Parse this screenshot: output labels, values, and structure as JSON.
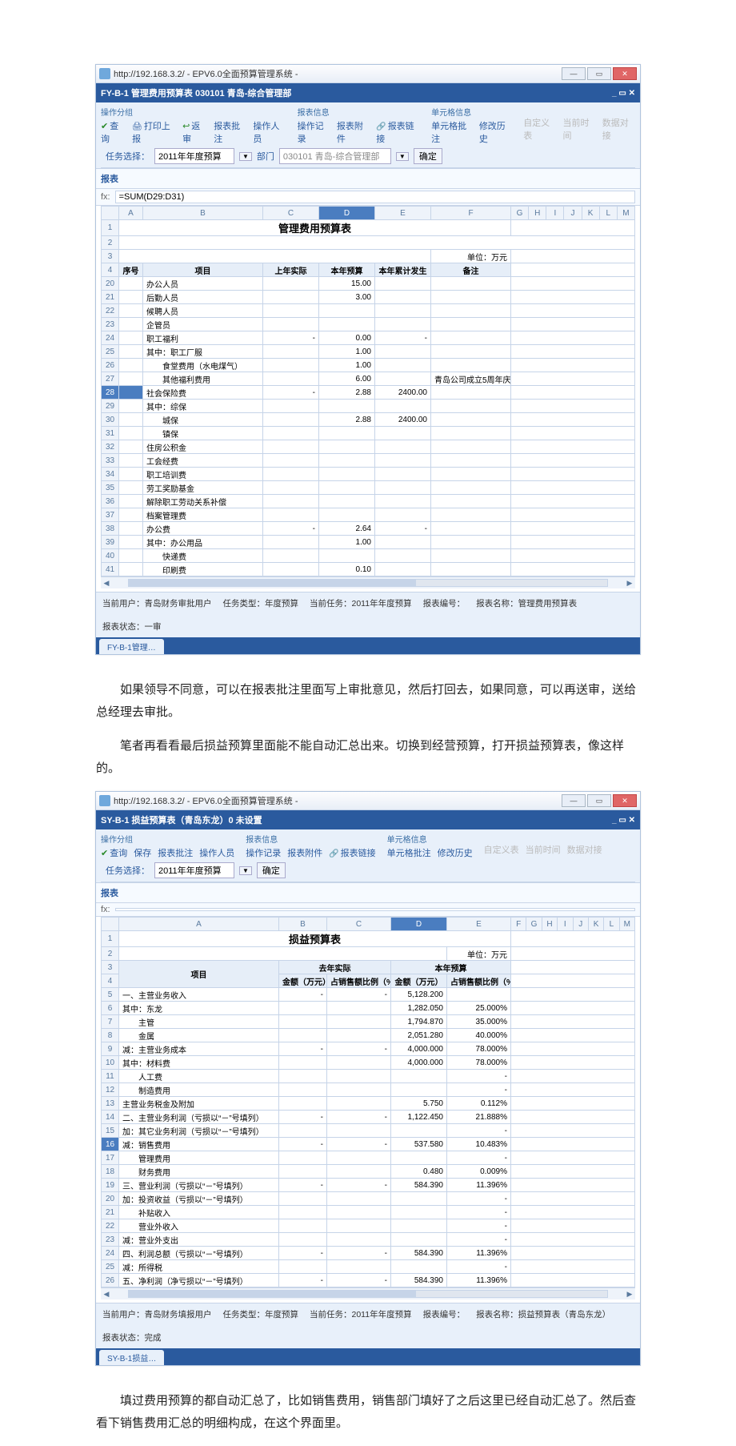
{
  "paragraphs": {
    "p1": "如果领导不同意，可以在报表批注里面写上审批意见，然后打回去，如果同意，可以再送审，送给总经理去审批。",
    "p2": "笔者再看看最后损益预算里面能不能自动汇总出来。切换到经营预算，打开损益预算表，像这样的。",
    "p3": "填过费用预算的都自动汇总了，比如销售费用，销售部门填好了之后这里已经自动汇总了。然后查看下销售费用汇总的明细构成，在这个界面里。"
  },
  "s1": {
    "window_title": "http://192.168.3.2/ - EPV6.0全面预算管理系统 -",
    "blue_title": "FY-B-1 管理费用预算表 030101 青岛-综合管理部",
    "ribbon": {
      "g1_title": "操作分组",
      "g1_items": [
        "查询",
        "打印上报",
        "返审",
        "报表批注",
        "操作人员"
      ],
      "g2_title": "报表信息",
      "g2_items": [
        "操作记录",
        "报表附件",
        "报表链接"
      ],
      "g3_title": "单元格信息",
      "g3_items": [
        "单元格批注",
        "修改历史"
      ],
      "g4_title": "",
      "g4_items": [
        "自定义表",
        "当前时间",
        "数据对接"
      ]
    },
    "task": {
      "lbl1": "任务选择：",
      "val1": "2011年年度预算",
      "lbl2": "部门",
      "val2": "030101 青岛-综合管理部",
      "btn": "确定"
    },
    "section": "报表",
    "fx": "=SUM(D29:D31)",
    "cols": [
      "A",
      "B",
      "C",
      "D",
      "E",
      "F",
      "G",
      "H",
      "I",
      "J",
      "K",
      "L",
      "M"
    ],
    "title": "管理费用预算表",
    "unit": "单位：万元",
    "header": {
      "c0": "序号",
      "c1": "项目",
      "c2": "上年实际",
      "c3": "本年预算",
      "c4": "本年累计发生",
      "c5": "备注"
    },
    "rows": [
      [
        20,
        "办公人员",
        "",
        "15.00",
        "",
        ""
      ],
      [
        21,
        "后勤人员",
        "",
        "3.00",
        "",
        ""
      ],
      [
        22,
        "候聘人员",
        "",
        "",
        "",
        ""
      ],
      [
        23,
        "企管员",
        "",
        "",
        "",
        ""
      ],
      [
        24,
        "职工福利",
        "-",
        "0.00",
        "-",
        ""
      ],
      [
        25,
        "其中：职工厂服",
        "",
        "1.00",
        "",
        ""
      ],
      [
        26,
        "　　食堂费用（水电煤气）",
        "",
        "1.00",
        "",
        ""
      ],
      [
        27,
        "　　其他福利费用",
        "",
        "6.00",
        "",
        "青岛公司成立5周年庆"
      ],
      [
        28,
        "社会保险费",
        "-",
        "2.88",
        "2400.00",
        ""
      ],
      [
        29,
        "其中：综保",
        "",
        "",
        "",
        ""
      ],
      [
        30,
        "　　城保",
        "",
        "2.88",
        "2400.00",
        ""
      ],
      [
        31,
        "　　镇保",
        "",
        "",
        "",
        ""
      ],
      [
        32,
        "住房公积金",
        "",
        "",
        "",
        ""
      ],
      [
        33,
        "工会经费",
        "",
        "",
        "",
        ""
      ],
      [
        34,
        "职工培训费",
        "",
        "",
        "",
        ""
      ],
      [
        35,
        "劳工奖励基金",
        "",
        "",
        "",
        ""
      ],
      [
        36,
        "解除职工劳动关系补偿",
        "",
        "",
        "",
        ""
      ],
      [
        37,
        "档案管理费",
        "",
        "",
        "",
        ""
      ],
      [
        38,
        "办公费",
        "-",
        "2.64",
        "-",
        ""
      ],
      [
        39,
        "其中：办公用品",
        "",
        "1.00",
        "",
        ""
      ],
      [
        40,
        "　　快递费",
        "",
        "",
        "",
        ""
      ],
      [
        41,
        "　　印刷费",
        "",
        "0.10",
        "",
        ""
      ]
    ],
    "status": {
      "user_lbl": "当前用户：",
      "user": "青岛财务审批用户",
      "type_lbl": "任务类型：",
      "type": "年度预算",
      "cur_lbl": "当前任务：",
      "cur": "2011年年度预算",
      "no_lbl": "报表编号：",
      "no": "",
      "name_lbl": "报表名称：",
      "name": "管理费用预算表",
      "state_lbl": "报表状态：",
      "state": "一审"
    },
    "tab": "FY-B-1管理…"
  },
  "s2": {
    "window_title": "http://192.168.3.2/ - EPV6.0全面预算管理系统 -",
    "blue_title": "SY-B-1 损益预算表（青岛东龙）0 未设置",
    "ribbon": {
      "g1_title": "操作分组",
      "g1_items": [
        "查询",
        "保存",
        "报表批注",
        "操作人员"
      ],
      "g2_title": "报表信息",
      "g2_items": [
        "操作记录",
        "报表附件",
        "报表链接"
      ],
      "g3_title": "单元格信息",
      "g3_items": [
        "单元格批注",
        "修改历史"
      ],
      "g4_title": "",
      "g4_items": [
        "自定义表",
        "当前时间",
        "数据对接"
      ]
    },
    "task": {
      "lbl1": "任务选择：",
      "val1": "2011年年度预算",
      "btn": "确定"
    },
    "section": "报表",
    "fx": "fx:",
    "cols": [
      "A",
      "B",
      "C",
      "D",
      "E",
      "F",
      "G",
      "H",
      "I",
      "J",
      "K",
      "L",
      "M"
    ],
    "title": "损益预算表",
    "unit": "单位：万元",
    "header": {
      "c0": "项目",
      "g1": "去年实际",
      "g1a": "金额（万元）",
      "g1b": "占销售额比例（%）",
      "g2": "本年预算",
      "g2a": "金额（万元）",
      "g2b": "占销售额比例（%）"
    },
    "rows": [
      [
        5,
        "一、主营业务收入",
        "-",
        "-",
        "5,128.200",
        ""
      ],
      [
        6,
        "其中：东龙",
        "",
        "",
        "1,282.050",
        "25.000%"
      ],
      [
        7,
        "　　主管",
        "",
        "",
        "1,794.870",
        "35.000%"
      ],
      [
        8,
        "　　金属",
        "",
        "",
        "2,051.280",
        "40.000%"
      ],
      [
        9,
        "减：主营业务成本",
        "-",
        "-",
        "4,000.000",
        "78.000%"
      ],
      [
        10,
        "其中：材料费",
        "",
        "",
        "4,000.000",
        "78.000%"
      ],
      [
        11,
        "　　人工费",
        "",
        "",
        "",
        "-"
      ],
      [
        12,
        "　　制造费用",
        "",
        "",
        "",
        "-"
      ],
      [
        13,
        "主营业务税金及附加",
        "",
        "",
        "5.750",
        "0.112%"
      ],
      [
        14,
        "二、主营业务利润（亏损以“－”号填列）",
        "-",
        "-",
        "1,122.450",
        "21.888%"
      ],
      [
        15,
        "加：其它业务利润（亏损以“－”号填列）",
        "",
        "",
        "",
        "-"
      ],
      [
        16,
        "减：销售费用",
        "-",
        "-",
        "537.580",
        "10.483%"
      ],
      [
        17,
        "　　管理费用",
        "",
        "",
        "",
        "-"
      ],
      [
        18,
        "　　财务费用",
        "",
        "",
        "0.480",
        "0.009%"
      ],
      [
        19,
        "三、营业利润（亏损以“－”号填列）",
        "-",
        "-",
        "584.390",
        "11.396%"
      ],
      [
        20,
        "加：投资收益（亏损以“－”号填列）",
        "",
        "",
        "",
        "-"
      ],
      [
        21,
        "　　补贴收入",
        "",
        "",
        "",
        "-"
      ],
      [
        22,
        "　　营业外收入",
        "",
        "",
        "",
        "-"
      ],
      [
        23,
        "减：营业外支出",
        "",
        "",
        "",
        "-"
      ],
      [
        24,
        "四、利润总额（亏损以“－”号填列）",
        "-",
        "-",
        "584.390",
        "11.396%"
      ],
      [
        25,
        "减：所得税",
        "",
        "",
        "",
        "-"
      ],
      [
        26,
        "五、净利润（净亏损以“－”号填列）",
        "-",
        "-",
        "584.390",
        "11.396%"
      ]
    ],
    "status": {
      "user_lbl": "当前用户：",
      "user": "青岛财务填报用户",
      "type_lbl": "任务类型：",
      "type": "年度预算",
      "cur_lbl": "当前任务：",
      "cur": "2011年年度预算",
      "no_lbl": "报表编号：",
      "no": "",
      "name_lbl": "报表名称：",
      "name": "损益预算表（青岛东龙）",
      "state_lbl": "报表状态：",
      "state": "完成"
    },
    "tab": "SY-B-1损益…"
  },
  "chart_data": [
    {
      "type": "table",
      "title": "管理费用预算表",
      "unit": "万元",
      "columns": [
        "项目",
        "上年实际",
        "本年预算",
        "本年累计发生",
        "备注"
      ],
      "rows": [
        [
          "办公人员",
          null,
          15.0,
          null,
          ""
        ],
        [
          "后勤人员",
          null,
          3.0,
          null,
          ""
        ],
        [
          "候聘人员",
          null,
          null,
          null,
          ""
        ],
        [
          "企管员",
          null,
          null,
          null,
          ""
        ],
        [
          "职工福利",
          null,
          0.0,
          null,
          ""
        ],
        [
          "其中：职工厂服",
          null,
          1.0,
          null,
          ""
        ],
        [
          "食堂费用（水电煤气）",
          null,
          1.0,
          null,
          ""
        ],
        [
          "其他福利费用",
          null,
          6.0,
          null,
          "青岛公司成立5周年庆"
        ],
        [
          "社会保险费",
          null,
          2.88,
          2400.0,
          ""
        ],
        [
          "其中：综保",
          null,
          null,
          null,
          ""
        ],
        [
          "城保",
          null,
          2.88,
          2400.0,
          ""
        ],
        [
          "镇保",
          null,
          null,
          null,
          ""
        ],
        [
          "住房公积金",
          null,
          null,
          null,
          ""
        ],
        [
          "工会经费",
          null,
          null,
          null,
          ""
        ],
        [
          "职工培训费",
          null,
          null,
          null,
          ""
        ],
        [
          "劳工奖励基金",
          null,
          null,
          null,
          ""
        ],
        [
          "解除职工劳动关系补偿",
          null,
          null,
          null,
          ""
        ],
        [
          "档案管理费",
          null,
          null,
          null,
          ""
        ],
        [
          "办公费",
          null,
          2.64,
          null,
          ""
        ],
        [
          "其中：办公用品",
          null,
          1.0,
          null,
          ""
        ],
        [
          "快递费",
          null,
          null,
          null,
          ""
        ],
        [
          "印刷费",
          null,
          0.1,
          null,
          ""
        ]
      ]
    },
    {
      "type": "table",
      "title": "损益预算表",
      "unit": "万元",
      "columns": [
        "项目",
        "去年实际-金额",
        "去年实际-占销售额比例",
        "本年预算-金额",
        "本年预算-占销售额比例"
      ],
      "rows": [
        [
          "主营业务收入",
          null,
          null,
          5128.2,
          null
        ],
        [
          "东龙",
          null,
          null,
          1282.05,
          0.25
        ],
        [
          "主管",
          null,
          null,
          1794.87,
          0.35
        ],
        [
          "金属",
          null,
          null,
          2051.28,
          0.4
        ],
        [
          "主营业务成本",
          null,
          null,
          4000.0,
          0.78
        ],
        [
          "材料费",
          null,
          null,
          4000.0,
          0.78
        ],
        [
          "主营业务税金及附加",
          null,
          null,
          5.75,
          0.00112
        ],
        [
          "主营业务利润",
          null,
          null,
          1122.45,
          0.21888
        ],
        [
          "销售费用",
          null,
          null,
          537.58,
          0.10483
        ],
        [
          "财务费用",
          null,
          null,
          0.48,
          9e-05
        ],
        [
          "营业利润",
          null,
          null,
          584.39,
          0.11396
        ],
        [
          "利润总额",
          null,
          null,
          584.39,
          0.11396
        ],
        [
          "净利润",
          null,
          null,
          584.39,
          0.11396
        ]
      ]
    }
  ]
}
